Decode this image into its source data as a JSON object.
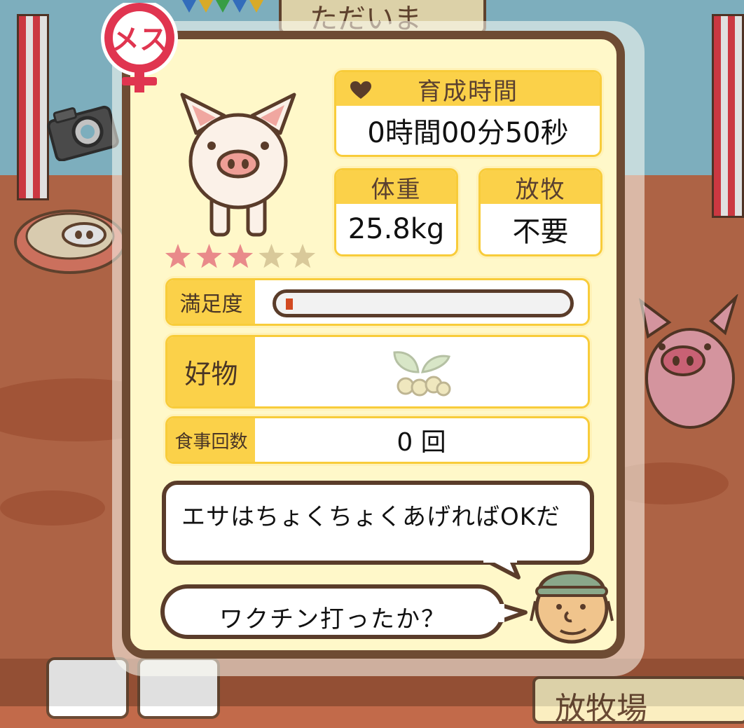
{
  "background": {
    "top_sign": "ただいま",
    "bottom_right_sign": "放牧場"
  },
  "pig": {
    "gender_label": "メス",
    "stars_filled": 3,
    "stars_total": 5,
    "icon": "pig-icon"
  },
  "stats": {
    "raising_time_label": "育成時間",
    "raising_time_value": "0時間00分50秒",
    "weight_label": "体重",
    "weight_value": "25.8kg",
    "grazing_label": "放牧",
    "grazing_value": "不要"
  },
  "rows": {
    "satisfaction_label": "満足度",
    "satisfaction_level": 0.02,
    "favorite_label": "好物",
    "favorite_icon": "soybean-icon",
    "meals_label": "食事回数",
    "meals_value": "0 回"
  },
  "messages": {
    "advice": "エサはちょくちょくあげればOKだ",
    "question": "ワクチン打ったか？"
  },
  "colors": {
    "panel_border": "#6e4b33",
    "panel_bg": "#fff8c9",
    "header_yellow": "#fbd149",
    "star_filled": "#e98a8a",
    "star_empty": "#d9c99a",
    "bar_fill": "#d24a22",
    "gender_red": "#e03550"
  }
}
